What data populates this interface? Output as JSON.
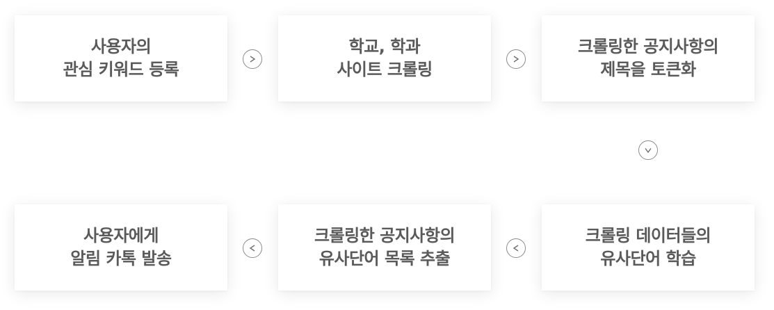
{
  "steps": [
    {
      "line1": "사용자의",
      "line2": "관심 키워드 등록"
    },
    {
      "line1": "학교, 학과",
      "line2": "사이트 크롤링"
    },
    {
      "line1": "크롤링한 공지사항의",
      "line2": "제목을 토큰화"
    },
    {
      "line1": "사용자에게",
      "line2": "알림 카톡 발송"
    },
    {
      "line1": "크롤링한 공지사항의",
      "line2": "유사단어 목록 추출"
    },
    {
      "line1": "크롤링 데이터들의",
      "line2": "유사단어 학습"
    }
  ],
  "arrows": {
    "right_icon": "chevron-right-icon",
    "down_icon": "chevron-down-icon",
    "left_icon": "chevron-left-icon",
    "stroke_color": "#6e6e6e",
    "border_color": "#8a8a8a"
  },
  "colors": {
    "text": "#5a5a5a",
    "card_bg": "#ffffff",
    "page_bg": "#ffffff"
  }
}
